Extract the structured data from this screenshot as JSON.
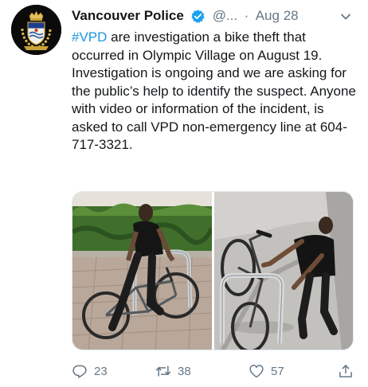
{
  "tweet": {
    "display_name": "Vancouver Police",
    "handle": "@...",
    "separator": "·",
    "date": "Aug 28",
    "hashtag": "#VPD",
    "text_body": " are investigation a bike theft that occurred in Olympic Village on August 19. Investigation is ongoing and we are asking for the public’s help to identify the suspect. Anyone with video or information of the incident, is asked to call VPD non-emergency line at 604-717-3321.",
    "media": [
      {
        "icon": "photo-bike-theft-1"
      },
      {
        "icon": "photo-bike-theft-2"
      }
    ],
    "actions": {
      "replies": "23",
      "retweets": "38",
      "likes": "57"
    }
  },
  "colors": {
    "accent": "#1da1f2",
    "hashtag": "#1b95e0",
    "muted": "#657786",
    "text": "#14171a"
  }
}
